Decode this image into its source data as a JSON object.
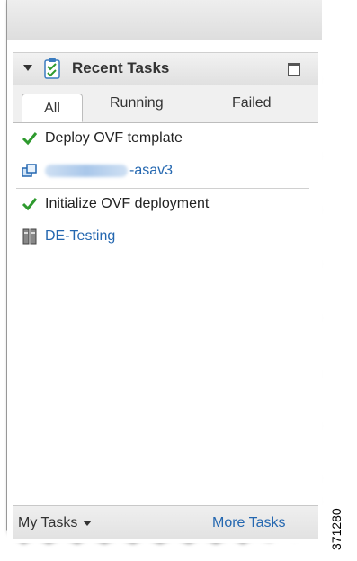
{
  "panel": {
    "title": "Recent Tasks",
    "collapse_icon": "caret-down-icon",
    "title_icon": "clipboard-check-icon",
    "maximize_icon": "maximize-icon"
  },
  "tabs": [
    {
      "label": "All",
      "active": true
    },
    {
      "label": "Running",
      "active": false
    },
    {
      "label": "Failed",
      "active": false
    }
  ],
  "tasks": [
    {
      "name": "Deploy OVF template",
      "status_icon": "checkmark-icon",
      "target_icon": "vm-icon",
      "target_suffix": "-asav3",
      "target_prefix_obscured": true
    },
    {
      "name": "Initialize OVF deployment",
      "status_icon": "checkmark-icon",
      "target_icon": "host-icon",
      "target": "DE-Testing"
    }
  ],
  "footer": {
    "my_tasks": "My Tasks",
    "more_tasks": "More Tasks"
  },
  "figure_number": "371280",
  "colors": {
    "link": "#2467b0",
    "success": "#2e9a2e"
  }
}
